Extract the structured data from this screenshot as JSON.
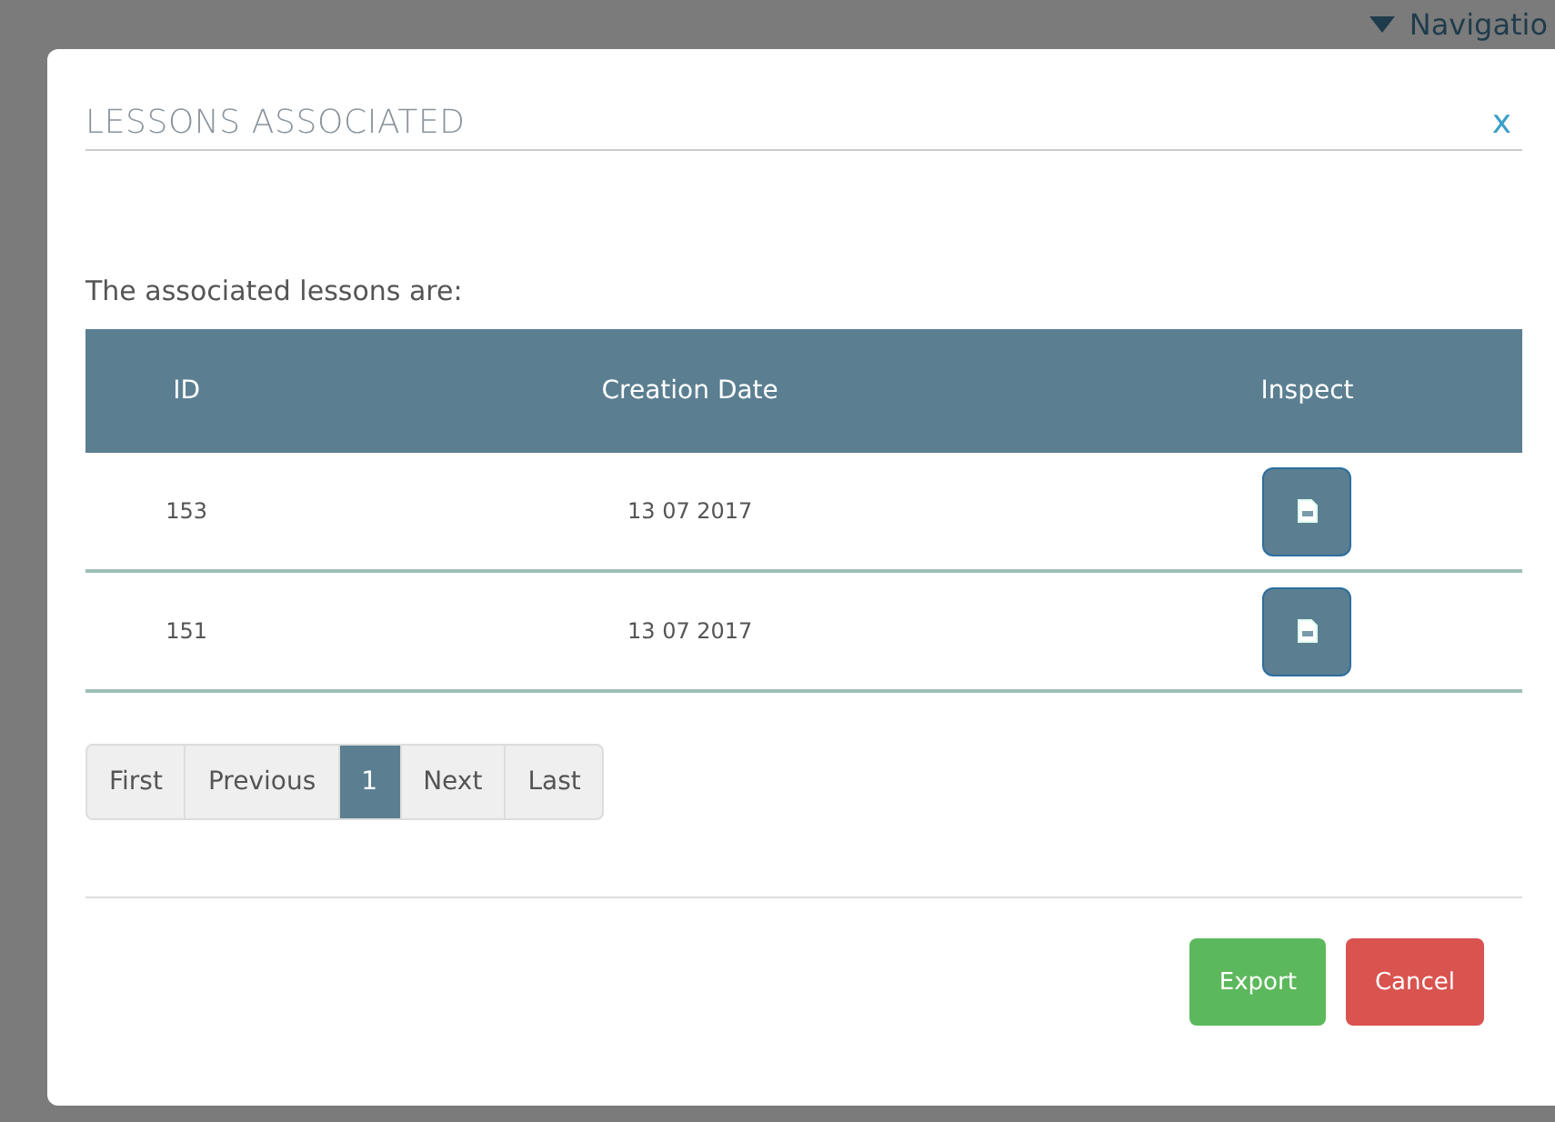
{
  "background": {
    "nav_label": "Navigatio"
  },
  "modal": {
    "title": "LESSONS ASSOCIATED",
    "close": "x",
    "intro": "The associated lessons are:",
    "table": {
      "columns": [
        "ID",
        "Creation Date",
        "Inspect"
      ],
      "rows": [
        {
          "id": "153",
          "date": "13 07 2017"
        },
        {
          "id": "151",
          "date": "13 07 2017"
        }
      ]
    },
    "pagination": [
      {
        "label": "First",
        "selected": false
      },
      {
        "label": "Previous",
        "selected": false
      },
      {
        "label": "1",
        "selected": true
      },
      {
        "label": "Next",
        "selected": false
      },
      {
        "label": "Last",
        "selected": false
      }
    ],
    "buttons": [
      {
        "label": "Export",
        "kind": "primary"
      },
      {
        "label": "Cancel",
        "kind": "danger"
      }
    ]
  }
}
